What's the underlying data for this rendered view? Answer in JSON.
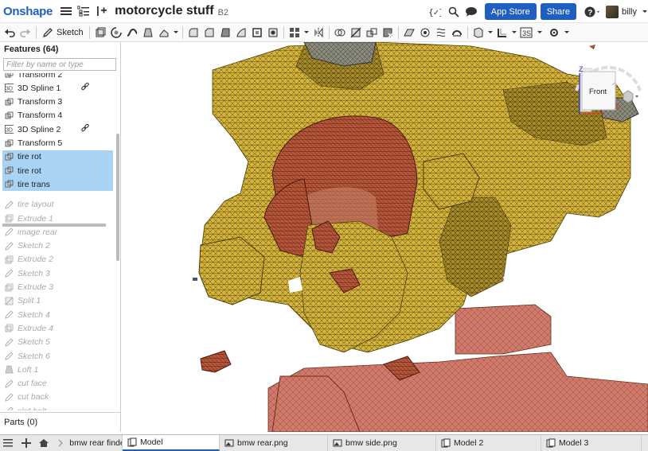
{
  "header": {
    "logo": "Onshape",
    "title": "motorcycle stuff",
    "version": "B2",
    "app_store": "App Store",
    "share": "Share",
    "user": "billy"
  },
  "toolbar": {
    "sketch_label": "Sketch"
  },
  "sidebar": {
    "features_title": "Features (64)",
    "filter_placeholder": "Filter by name or type",
    "items": [
      {
        "label": "Transform 2",
        "icon": "transform-icon",
        "state": "normal"
      },
      {
        "label": "3D Spline 1",
        "icon": "spline-icon",
        "state": "normal",
        "linked": true
      },
      {
        "label": "Transform 3",
        "icon": "transform-icon",
        "state": "normal"
      },
      {
        "label": "Transform 4",
        "icon": "transform-icon",
        "state": "normal"
      },
      {
        "label": "3D Spline 2",
        "icon": "spline-icon",
        "state": "normal",
        "linked": true
      },
      {
        "label": "Transform 5",
        "icon": "transform-icon",
        "state": "normal"
      },
      {
        "label": "tire rot",
        "icon": "transform-icon",
        "state": "selected"
      },
      {
        "label": "tire rot",
        "icon": "transform-icon",
        "state": "selected"
      },
      {
        "label": "tire trans",
        "icon": "transform-icon",
        "state": "selected"
      },
      {
        "label": "tire layout",
        "icon": "sketch-icon",
        "state": "rolled-back"
      },
      {
        "label": "Extrude 1",
        "icon": "extrude-icon",
        "state": "rolled-back"
      },
      {
        "label": "image rear",
        "icon": "sketch-icon",
        "state": "rolled-back"
      },
      {
        "label": "Sketch 2",
        "icon": "sketch-icon",
        "state": "rolled-back"
      },
      {
        "label": "Extrude 2",
        "icon": "extrude-icon",
        "state": "rolled-back"
      },
      {
        "label": "Sketch 3",
        "icon": "sketch-icon",
        "state": "rolled-back"
      },
      {
        "label": "Extrude 3",
        "icon": "extrude-icon",
        "state": "rolled-back"
      },
      {
        "label": "Split 1",
        "icon": "split-icon",
        "state": "rolled-back"
      },
      {
        "label": "Sketch 4",
        "icon": "sketch-icon",
        "state": "rolled-back"
      },
      {
        "label": "Extrude 4",
        "icon": "extrude-icon",
        "state": "rolled-back"
      },
      {
        "label": "Sketch 5",
        "icon": "sketch-icon",
        "state": "rolled-back"
      },
      {
        "label": "Sketch 6",
        "icon": "sketch-icon",
        "state": "rolled-back"
      },
      {
        "label": "Loft 1",
        "icon": "loft-icon",
        "state": "rolled-back"
      },
      {
        "label": "cut face",
        "icon": "sketch-icon",
        "state": "rolled-back"
      },
      {
        "label": "cut back",
        "icon": "sketch-icon",
        "state": "rolled-back"
      },
      {
        "label": "slot bolt",
        "icon": "sketch-icon",
        "state": "rolled-back"
      }
    ],
    "parts_title": "Parts (0)"
  },
  "viewcube": {
    "face_label": "Front",
    "z_label": "Z",
    "x_label": "X"
  },
  "tabs": [
    {
      "label": "bmw rear finder",
      "type": "folder",
      "active": false
    },
    {
      "label": "Model",
      "type": "partstudio",
      "active": true
    },
    {
      "label": "bmw rear.png",
      "type": "image",
      "active": false
    },
    {
      "label": "bmw side.png",
      "type": "image",
      "active": false
    },
    {
      "label": "Model 2",
      "type": "partstudio",
      "active": false
    },
    {
      "label": "Model 3",
      "type": "partstudio",
      "active": false
    }
  ],
  "colors": {
    "accent": "#1f5fbf",
    "selection": "#a8d3f5",
    "mesh_yellow": "#d4b43a",
    "mesh_copper": "#b5563a",
    "mesh_salmon": "#cf7a6a"
  }
}
